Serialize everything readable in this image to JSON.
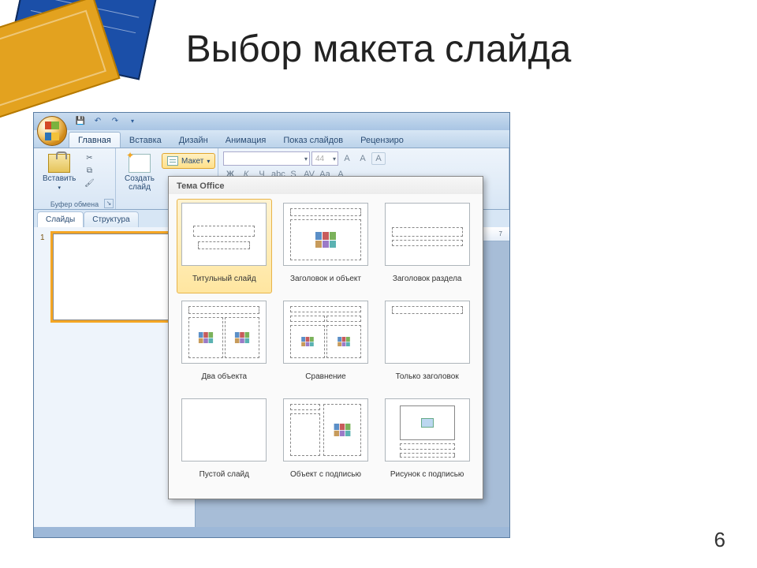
{
  "slide_title": "Выбор макета слайда",
  "page_number": "6",
  "qat": {
    "save": "💾",
    "undo": "↶",
    "redo": "↷"
  },
  "ribbon_tabs": {
    "home": "Главная",
    "insert": "Вставка",
    "design": "Дизайн",
    "animation": "Анимация",
    "slideshow": "Показ слайдов",
    "review": "Рецензиро"
  },
  "ribbon": {
    "paste": "Вставить",
    "clipboard_group": "Буфер обмена",
    "new_slide": "Создать слайд",
    "layout_btn": "Макет",
    "font_size": "44"
  },
  "side_tabs": {
    "slides": "Слайды",
    "outline": "Структура"
  },
  "thumb_number": "1",
  "ruler_marks": "7",
  "gallery": {
    "header": "Тема Office",
    "items": [
      {
        "key": "title",
        "label": "Титульный слайд"
      },
      {
        "key": "title_content",
        "label": "Заголовок и объект"
      },
      {
        "key": "section",
        "label": "Заголовок раздела"
      },
      {
        "key": "two_content",
        "label": "Два объекта"
      },
      {
        "key": "comparison",
        "label": "Сравнение"
      },
      {
        "key": "title_only",
        "label": "Только заголовок"
      },
      {
        "key": "blank",
        "label": "Пустой слайд"
      },
      {
        "key": "content_caption",
        "label": "Объект с подписью"
      },
      {
        "key": "picture_caption",
        "label": "Рисунок с подписью"
      }
    ]
  }
}
